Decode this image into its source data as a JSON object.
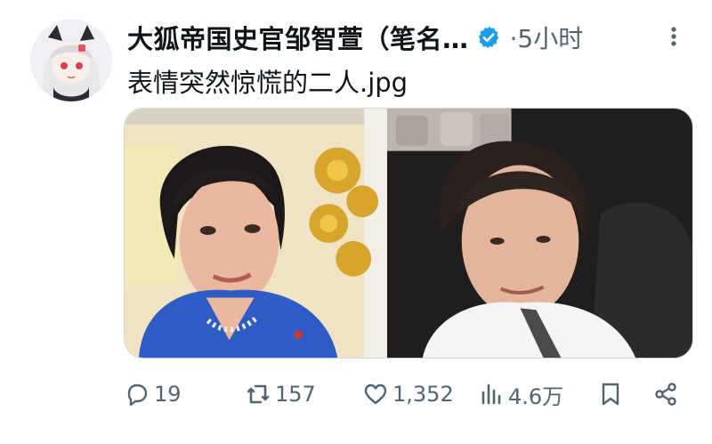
{
  "post": {
    "display_name": "大狐帝国史官邹智萱（笔名…",
    "time": "·5小时",
    "text": "表情突然惊慌的二人.jpg"
  },
  "icons": {
    "verified": "verified-badge-icon",
    "more": "more-options-icon",
    "reply": "reply-icon",
    "retweet": "retweet-icon",
    "like": "heart-icon",
    "views": "views-chart-icon",
    "bookmark": "bookmark-icon",
    "share": "share-icon"
  },
  "actions": {
    "reply_count": "19",
    "retweet_count": "157",
    "like_count": "1,352",
    "views_count": "4.6万"
  },
  "colors": {
    "verified": "#1d9bf0",
    "secondary_text": "#536471",
    "primary_text": "#0f1419"
  }
}
